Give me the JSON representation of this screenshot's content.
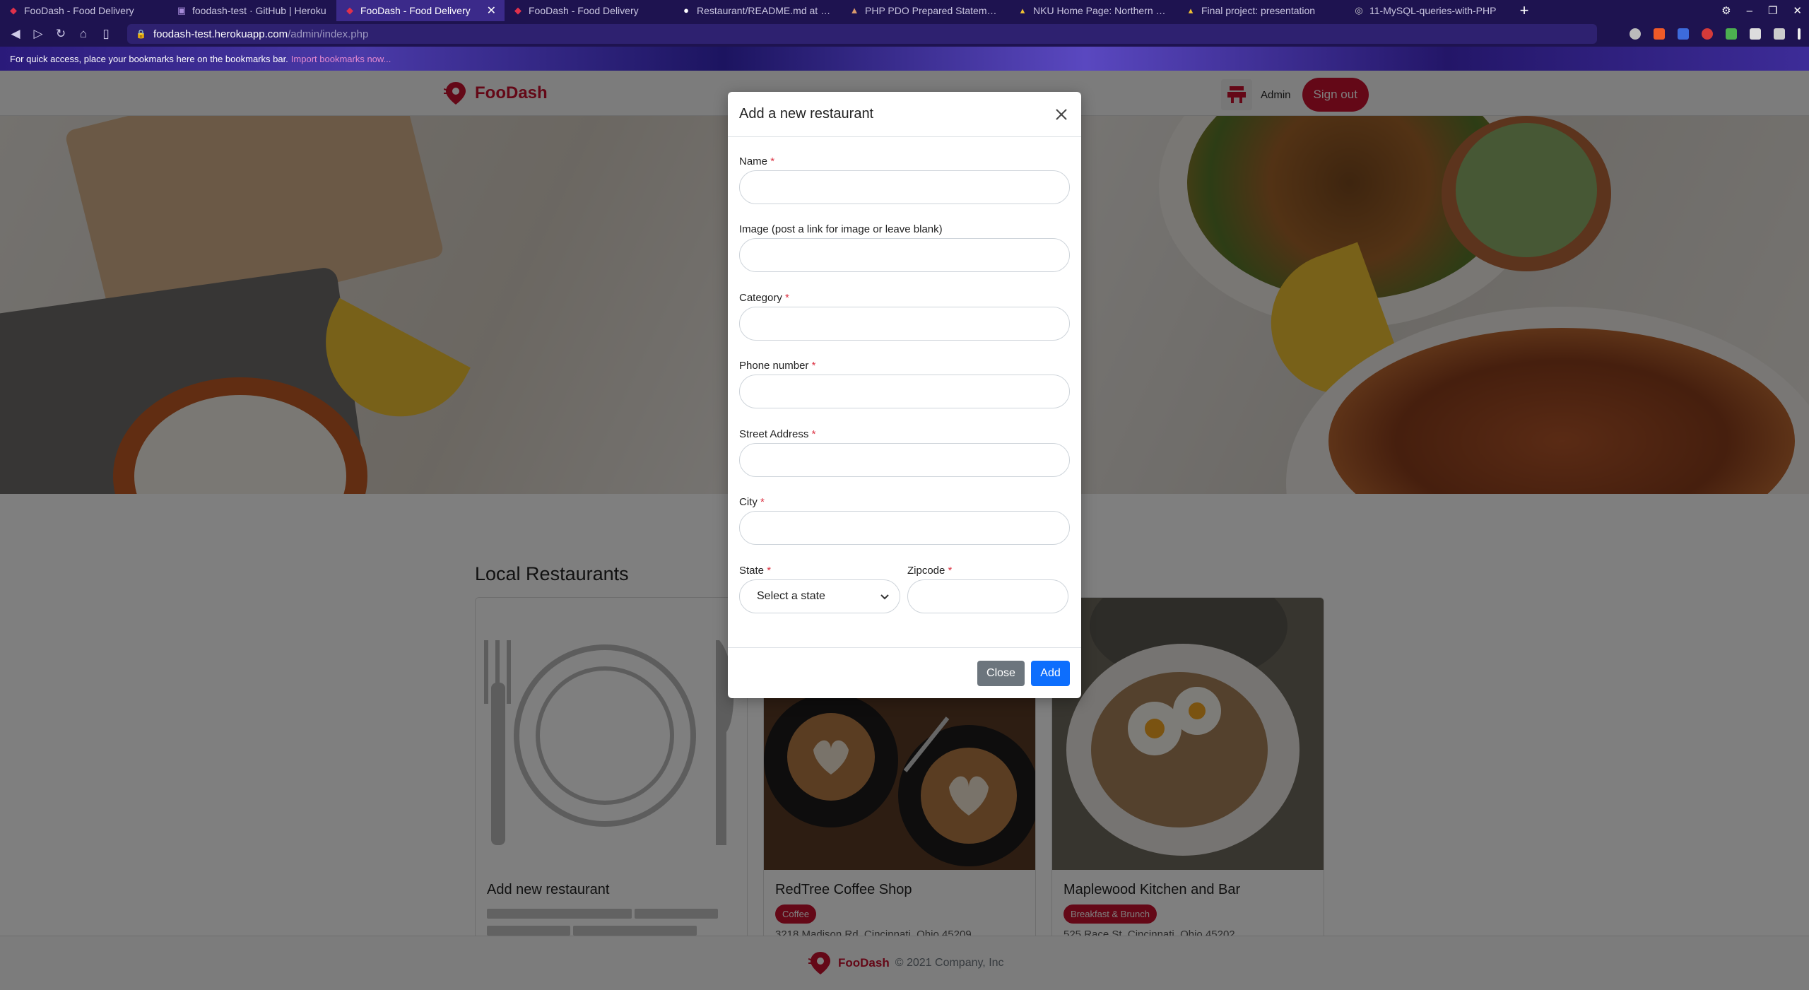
{
  "browser": {
    "tabs": [
      {
        "title": "FooDash - Food Delivery",
        "icon": "foodash-icon",
        "active": false
      },
      {
        "title": "foodash-test · GitHub | Heroku",
        "icon": "heroku-icon",
        "active": false
      },
      {
        "title": "FooDash - Food Delivery",
        "icon": "foodash-icon",
        "active": true
      },
      {
        "title": "FooDash - Food Delivery",
        "icon": "foodash-icon",
        "active": false
      },
      {
        "title": "Restaurant/README.md at main",
        "icon": "github-icon",
        "active": false
      },
      {
        "title": "PHP PDO Prepared Statements T",
        "icon": "php-icon",
        "active": false
      },
      {
        "title": "NKU Home Page: Northern Kent",
        "icon": "nku-icon",
        "active": false
      },
      {
        "title": "Final project: presentation",
        "icon": "nku-icon",
        "active": false
      },
      {
        "title": "11-MySQL-queries-with-PHP",
        "icon": "globe-icon",
        "active": false
      }
    ],
    "url_host": "foodash-test.herokuapp.com",
    "url_path": "/admin/index.php",
    "bookmarks_text": "For quick access, place your bookmarks here on the bookmarks bar.",
    "bookmarks_link": "Import bookmarks now..."
  },
  "navbar": {
    "brand": "FooDash",
    "admin_label": "Admin",
    "signout_label": "Sign out"
  },
  "main": {
    "section_title": "Local Restaurants",
    "cards": [
      {
        "title": "Add new restaurant",
        "badge": "",
        "address": ""
      },
      {
        "title": "RedTree Coffee Shop",
        "badge": "Coffee",
        "address": "3218 Madison Rd, Cincinnati, Ohio 45209"
      },
      {
        "title": "Maplewood Kitchen and Bar",
        "badge": "Breakfast & Brunch",
        "address": "525 Race St, Cincinnati, Ohio 45202"
      }
    ]
  },
  "footer": {
    "brand": "FooDash",
    "copyright": "© 2021 Company, Inc"
  },
  "modal": {
    "title": "Add a new restaurant",
    "fields": {
      "name": {
        "label": "Name",
        "required": "*",
        "value": ""
      },
      "image": {
        "label": "Image (post a link for image or leave blank)",
        "value": ""
      },
      "category": {
        "label": "Category",
        "required": "*",
        "value": ""
      },
      "phone": {
        "label": "Phone number",
        "required": "*",
        "value": ""
      },
      "street": {
        "label": "Street Address",
        "required": "*",
        "value": ""
      },
      "city": {
        "label": "City",
        "required": "*",
        "value": ""
      },
      "state": {
        "label": "State",
        "required": "*",
        "selected": "Select a state"
      },
      "zipcode": {
        "label": "Zipcode",
        "required": "*",
        "value": ""
      }
    },
    "close_label": "Close",
    "add_label": "Add"
  },
  "colors": {
    "brand_red": "#c8102e",
    "primary_blue": "#0d6efd",
    "secondary_gray": "#6c757d",
    "browser_chrome": "#1e1350"
  }
}
